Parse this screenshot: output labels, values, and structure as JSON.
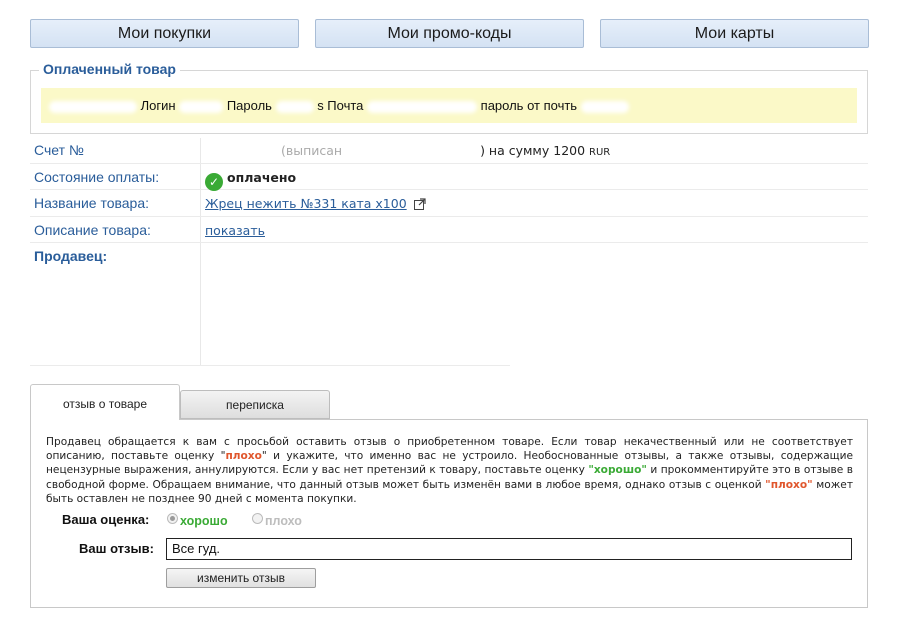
{
  "nav": {
    "purchases": "Мои покупки",
    "promocodes": "Мои промо-коды",
    "cards": "Мои карты"
  },
  "paid_item": {
    "legend": "Оплаченный товар",
    "t1": "Логин",
    "t2": "Пароль",
    "t3": "s Почта",
    "t4": "пароль от почть"
  },
  "details": {
    "invoice_label": "Счет №",
    "invoice_issued": "(выписан",
    "invoice_sum": ") на сумму 1200",
    "invoice_currency": "RUR",
    "status_label": "Состояние оплаты:",
    "status_value": "оплачено",
    "name_label": "Название товара:",
    "name_value": "Жрец нежить №331 ката x100",
    "desc_label": "Описание товара:",
    "desc_value": "показать",
    "seller_label": "Продавец",
    "seller_colon": ":"
  },
  "tabs": {
    "review": "отзыв о товаре",
    "correspondence": "переписка"
  },
  "notice": {
    "p1": "Продавец обращается к вам с просьбой оставить отзыв о приобретенном товаре. Если товар некачественный или не соответствует описанию, поставьте оценку ",
    "q1": "\"",
    "bad_word": "плохо",
    "q2": "\"",
    "p2": " и укажите, что именно вас не устроило. Необоснованные отзывы, а также отзывы, содержащие нецензурные выражения, аннулируются. Если у вас нет претензий к товару, поставьте оценку ",
    "q3": "\"",
    "good_word": "хорошо",
    "q4": "\"",
    "p3": " и прокомментируйте это в отзыве в свободной форме. Обращаем внимание, что данный отзыв может быть изменён вами в любое время, однако отзыв с оценкой ",
    "q5": "\"",
    "bad_word2": "плохо",
    "q6": "\"",
    "p4": " может быть оставлен не позднее 90 дней с момента покупки."
  },
  "review": {
    "rating_label": "Ваша оценка:",
    "good": "хорошо",
    "bad": "плохо",
    "selected": "хорошо",
    "text_label": "Ваш отзыв:",
    "text_value": "Все гуд.",
    "change_button": "изменить отзыв"
  },
  "colors": {
    "link": "#2a5d9a",
    "good": "#3aaa35",
    "bad": "#e0562c",
    "highlight": "#fbf9c8"
  }
}
